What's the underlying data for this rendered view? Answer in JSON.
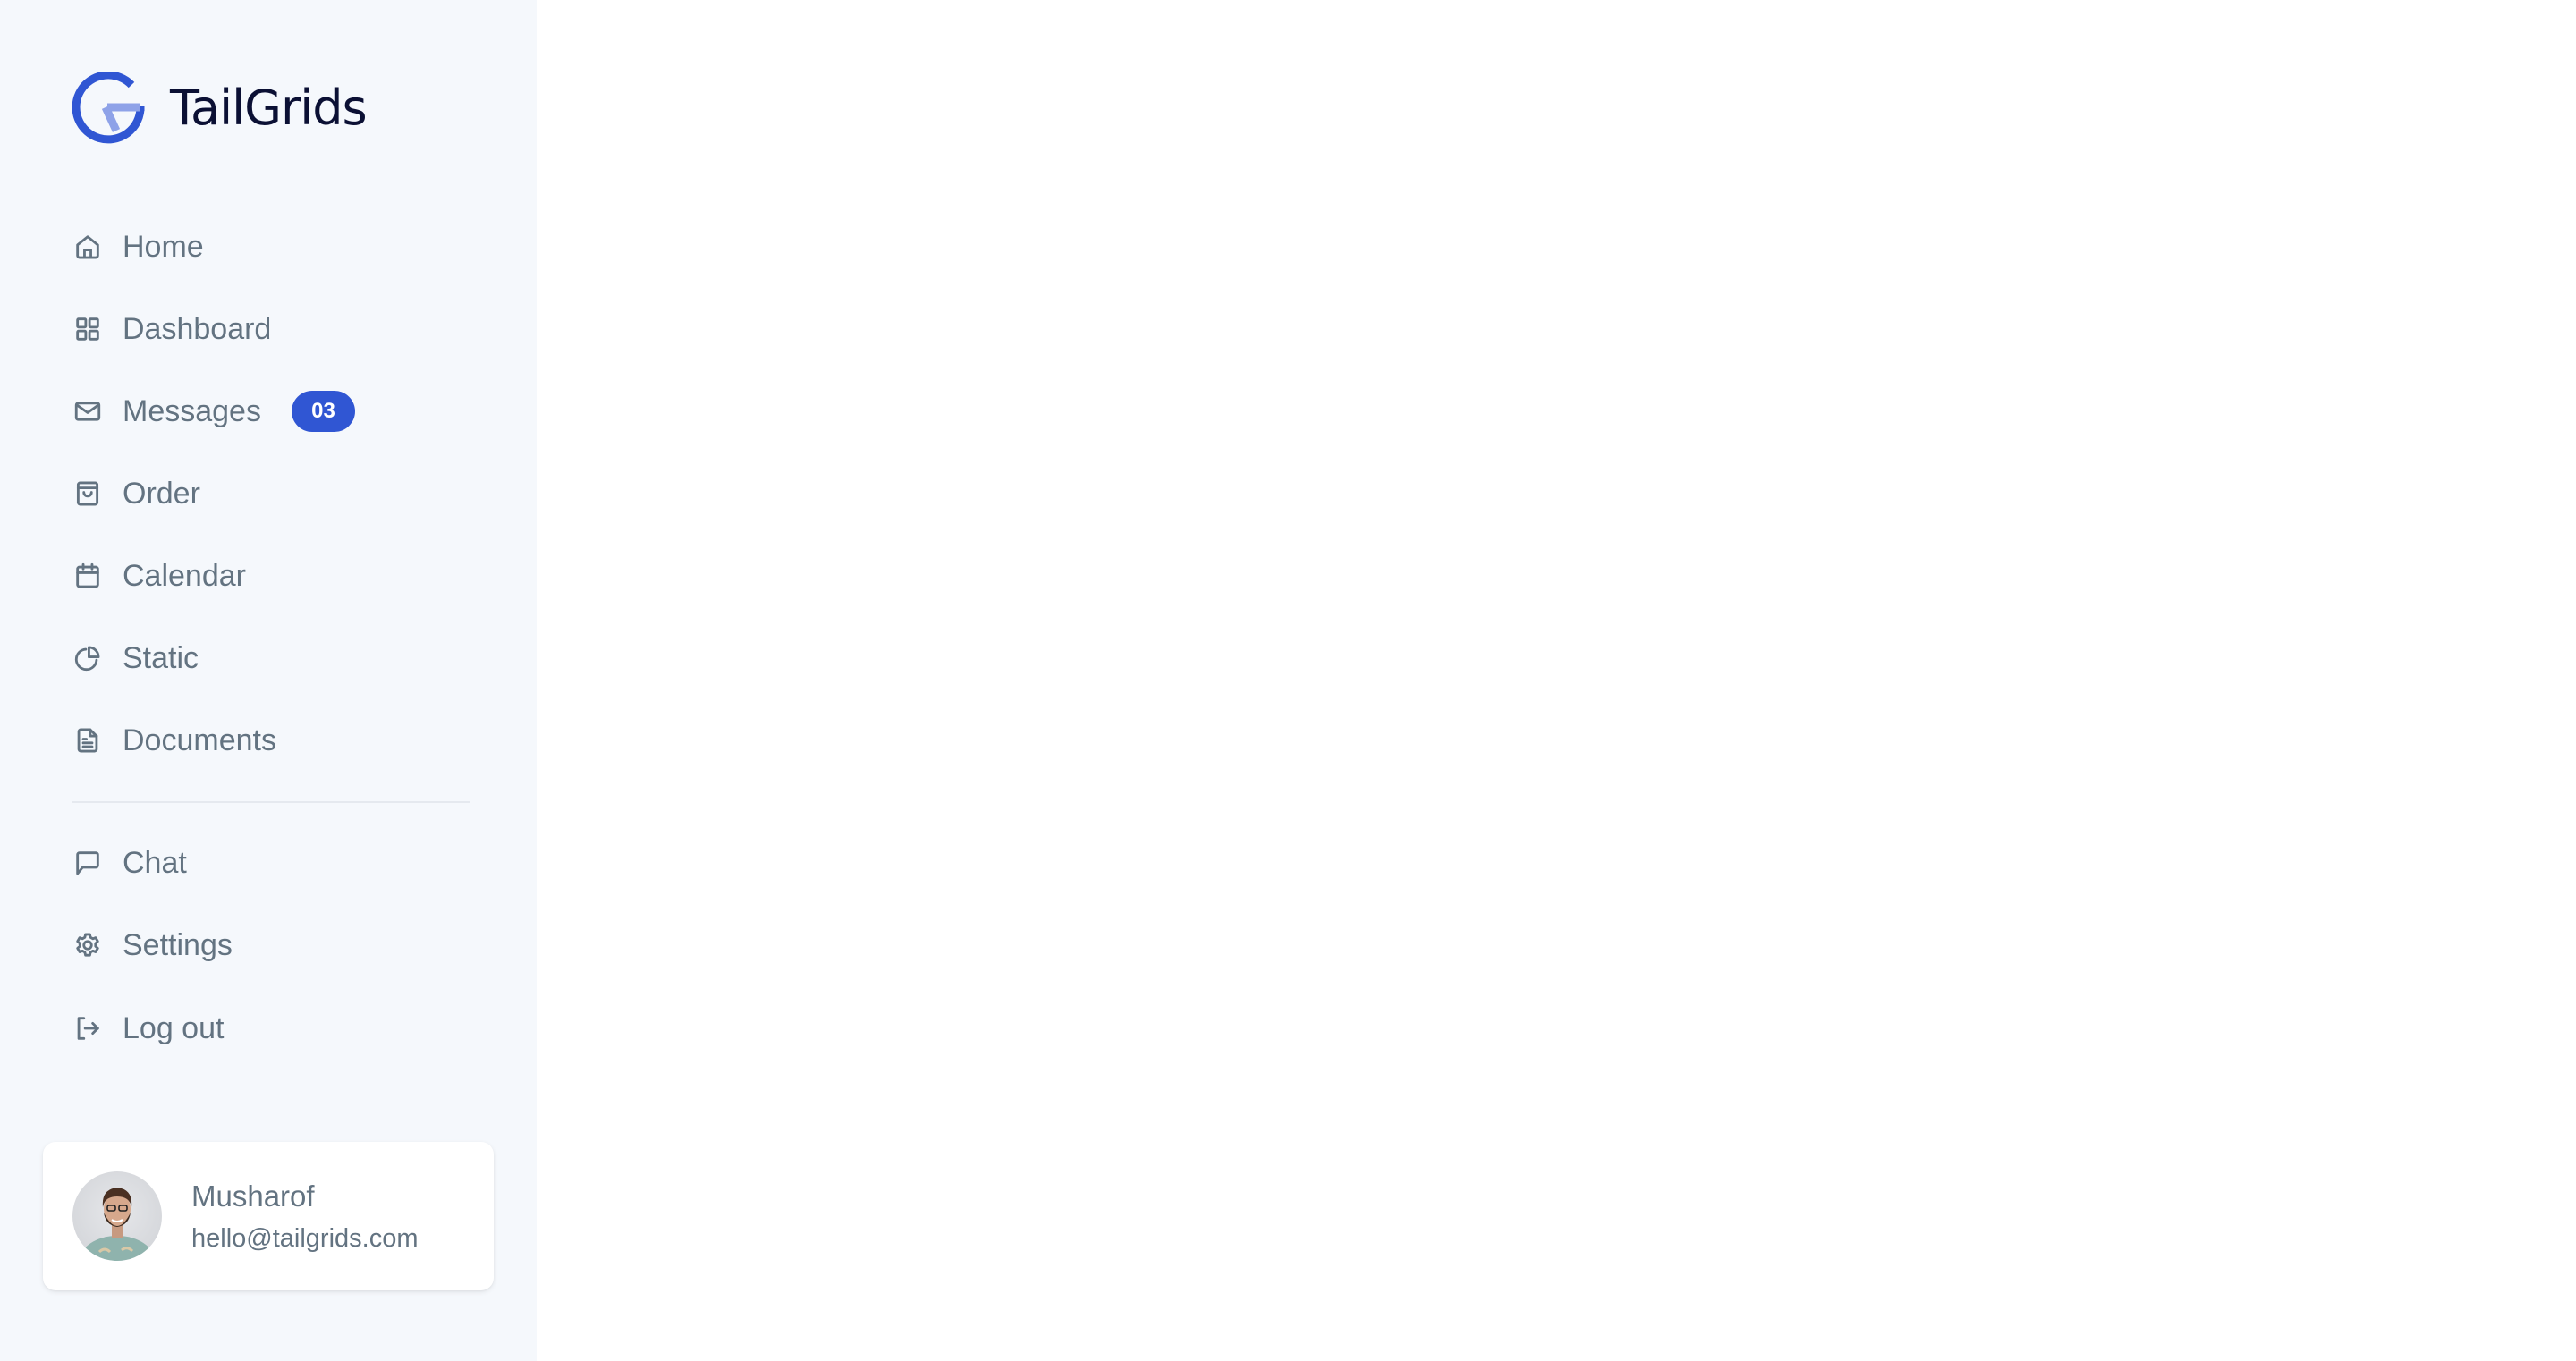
{
  "brand": {
    "name": "TailGrids",
    "accent": "#3056d3"
  },
  "sidebar": {
    "main_items": [
      {
        "label": "Home",
        "icon": "home-icon"
      },
      {
        "label": "Dashboard",
        "icon": "grid-icon"
      },
      {
        "label": "Messages",
        "icon": "mail-icon",
        "badge": "03"
      },
      {
        "label": "Order",
        "icon": "shopping-bag-icon"
      },
      {
        "label": "Calendar",
        "icon": "calendar-icon"
      },
      {
        "label": "Static",
        "icon": "pie-chart-icon"
      },
      {
        "label": "Documents",
        "icon": "document-icon"
      }
    ],
    "secondary_items": [
      {
        "label": "Chat",
        "icon": "chat-icon"
      },
      {
        "label": "Settings",
        "icon": "gear-icon"
      },
      {
        "label": "Log out",
        "icon": "logout-icon"
      }
    ]
  },
  "user": {
    "name": "Musharof",
    "email": "hello@tailgrids.com"
  }
}
